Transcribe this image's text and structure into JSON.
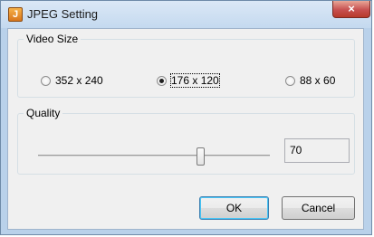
{
  "window": {
    "title": "JPEG Setting",
    "icon": "jpeg-app-icon",
    "close_glyph": "×"
  },
  "video_size": {
    "legend": "Video Size",
    "options": [
      {
        "label": "352 x 240",
        "selected": false
      },
      {
        "label": "176 x 120",
        "selected": true
      },
      {
        "label": "88 x 60",
        "selected": false
      }
    ]
  },
  "quality": {
    "legend": "Quality",
    "value": "70",
    "slider_min": 0,
    "slider_max": 100,
    "slider_value": 70
  },
  "buttons": {
    "ok": "OK",
    "cancel": "Cancel"
  },
  "colors": {
    "accent_close": "#c75050",
    "default_button_border": "#3c7fb1"
  }
}
